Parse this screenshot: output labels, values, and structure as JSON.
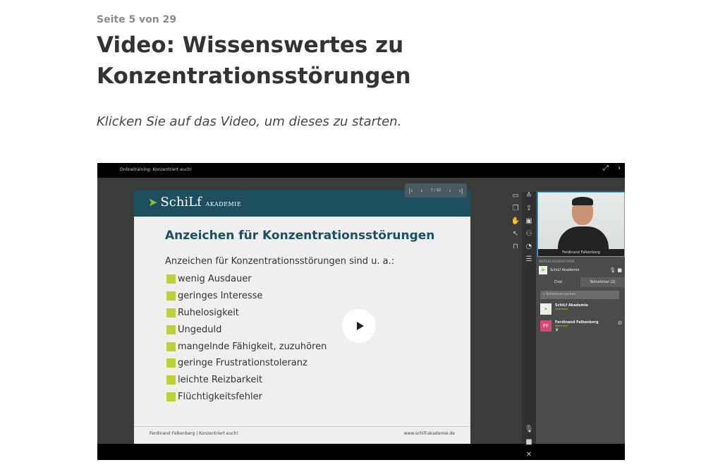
{
  "page": {
    "counter": "Seite 5 von 29",
    "title": "Video: Wissenswertes zu Konzentrationsstörungen",
    "instruction": "Klicken Sie auf das Video, um dieses zu starten."
  },
  "video": {
    "window_title": "Onlinetraining: Konzentriert euch!",
    "fullscreen_icon": "fullscreen-icon",
    "next_icon": "chevron-right-icon",
    "slide": {
      "logo_main": "SchiLf",
      "logo_sub": "AKADEMIE",
      "nav_page": "7 / 32",
      "heading": "Anzeichen für Konzentrationsstörungen",
      "intro": "Anzeichen für Konzentrationsstörungen sind u. a.:",
      "items": [
        "wenig Ausdauer",
        "geringes Interesse",
        "Ruhelosigkeit",
        "Ungeduld",
        "mangelnde Fähigkeit, zuzuhören",
        "geringe Frustrationstoleranz",
        "leichte Reizbarkeit",
        "Flüchtigkeitsfehler"
      ],
      "footer_left": "Ferdinand Falkenberg | Konzentriert euch!",
      "footer_right": "www.schilf-akademie.de",
      "bullet_color": "#bfcf3a",
      "header_color": "#1e4f5f"
    },
    "panel": {
      "cam_name": "Ferdinand Falkenberg",
      "section_label": "WEITERE MODERATOREN",
      "moderator": "SchiLf Akademie",
      "tabs": [
        "Chat",
        "Teilnehmer (2)"
      ],
      "search_placeholder": "Teilnehmer suchen",
      "participants": [
        {
          "initials": "",
          "name": "SchiLf Akademie",
          "role": "Moderator"
        },
        {
          "initials": "FF",
          "name": "Ferdinand Falkenberg",
          "role": "Moderator"
        }
      ]
    }
  }
}
